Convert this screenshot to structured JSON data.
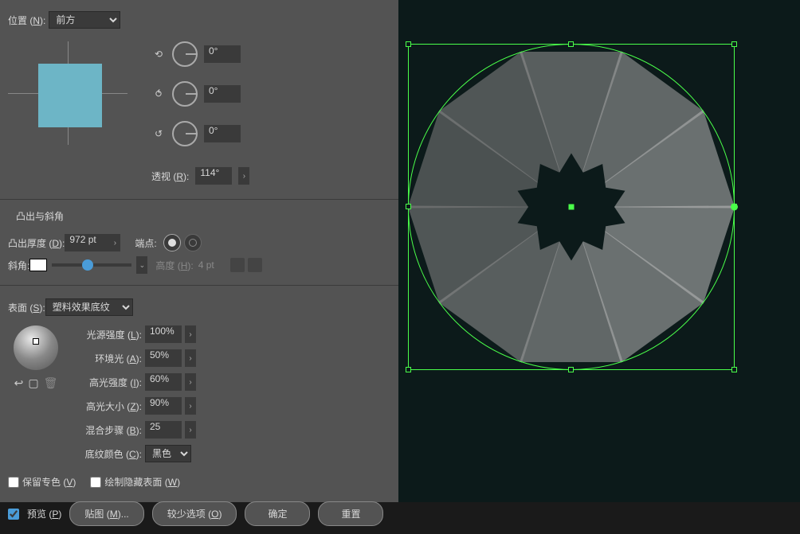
{
  "position": {
    "label": "位置",
    "hotkey": "N",
    "value": "前方",
    "rot1": "0°",
    "rot2": "0°",
    "rot3": "0°",
    "perspective_label": "透视",
    "perspective_hotkey": "R",
    "perspective_value": "114°"
  },
  "bevel": {
    "title": "凸出与斜角",
    "depth_label": "凸出厚度",
    "depth_hotkey": "D",
    "depth_value": "972 pt",
    "cap_label": "端点:",
    "bevel_label": "斜角:",
    "height_label": "高度",
    "height_hotkey": "H",
    "height_value": "4 pt"
  },
  "surface": {
    "label": "表面",
    "hotkey": "S",
    "value": "塑料效果底纹",
    "intensity_label": "光源强度",
    "intensity_hotkey": "L",
    "intensity_value": "100%",
    "ambient_label": "环境光",
    "ambient_hotkey": "A",
    "ambient_value": "50%",
    "highlight_intensity_label": "高光强度",
    "highlight_intensity_hotkey": "I",
    "highlight_intensity_value": "60%",
    "highlight_size_label": "高光大小",
    "highlight_size_hotkey": "Z",
    "highlight_size_value": "90%",
    "blend_label": "混合步骤",
    "blend_hotkey": "B",
    "blend_value": "25",
    "shading_label": "底纹颜色",
    "shading_hotkey": "C",
    "shading_value": "黑色"
  },
  "checkboxes": {
    "preserve_spot": "保留专色",
    "preserve_spot_hotkey": "V",
    "draw_hidden": "绘制隐藏表面",
    "draw_hidden_hotkey": "W",
    "preview": "预览",
    "preview_hotkey": "P"
  },
  "buttons": {
    "map_art": "贴图",
    "map_art_hotkey": "M",
    "fewer_options": "较少选项",
    "fewer_options_hotkey": "O",
    "ok": "确定",
    "reset": "重置"
  }
}
